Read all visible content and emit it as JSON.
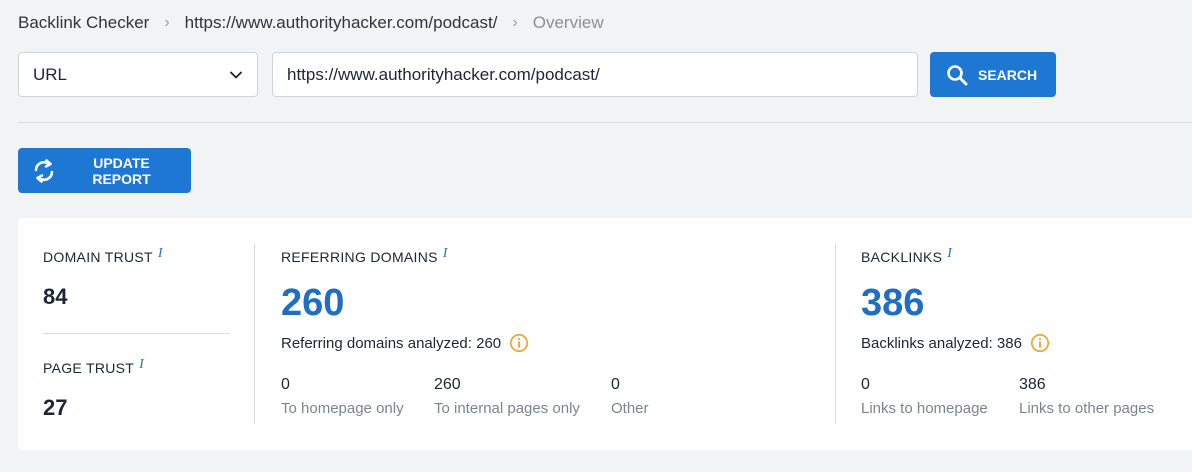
{
  "breadcrumb": {
    "items": [
      "Backlink Checker",
      "https://www.authorityhacker.com/podcast/",
      "Overview"
    ],
    "separator": "›"
  },
  "search": {
    "mode_select": "URL",
    "input_value": "https://www.authorityhacker.com/podcast/",
    "button_label": "SEARCH"
  },
  "update_button_label": "UPDATE REPORT",
  "colors": {
    "accent": "#1f77d4",
    "big_number": "#1f6dc5",
    "info_icon": "#f0a020"
  },
  "metrics": {
    "domain_trust": {
      "label": "DOMAIN TRUST",
      "info": "i",
      "value": "84"
    },
    "page_trust": {
      "label": "PAGE TRUST",
      "info": "i",
      "value": "27"
    },
    "referring_domains": {
      "label": "REFERRING DOMAINS",
      "info": "i",
      "value": "260",
      "analyzed_text": "Referring domains analyzed: 260",
      "breakdown": [
        {
          "value": "0",
          "label": "To homepage only"
        },
        {
          "value": "260",
          "label": "To internal pages only"
        },
        {
          "value": "0",
          "label": "Other"
        }
      ]
    },
    "backlinks": {
      "label": "BACKLINKS",
      "info": "i",
      "value": "386",
      "analyzed_text": "Backlinks analyzed: 386",
      "breakdown": [
        {
          "value": "0",
          "label": "Links to homepage"
        },
        {
          "value": "386",
          "label": "Links to other pages"
        }
      ]
    }
  }
}
